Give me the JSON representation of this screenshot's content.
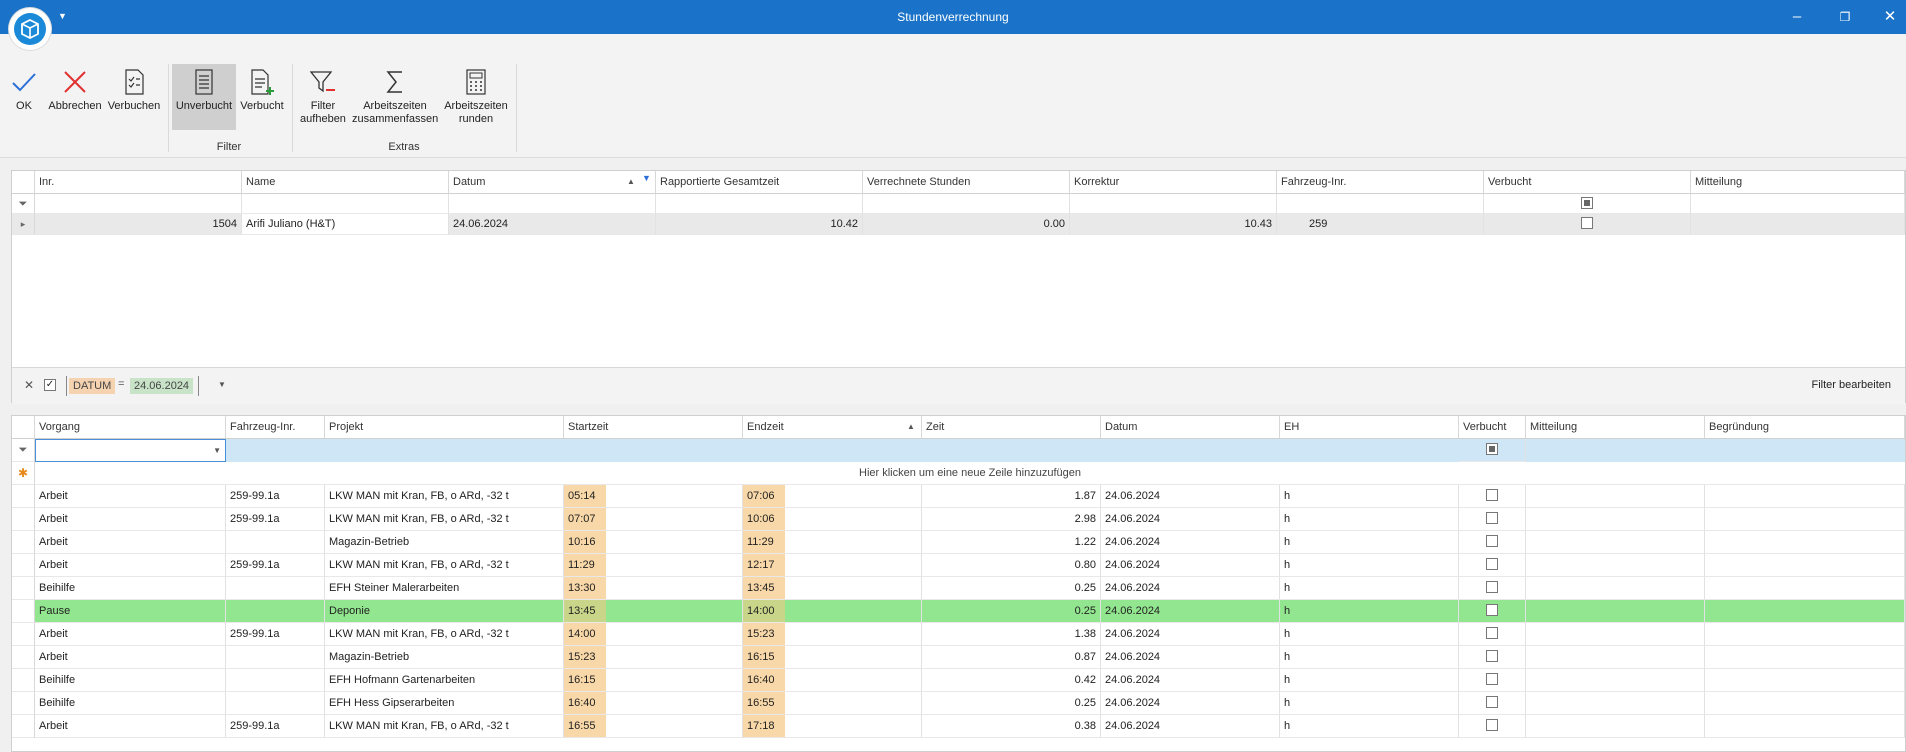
{
  "window": {
    "title": "Stundenverrechnung"
  },
  "ribbon": {
    "buttons": {
      "ok": "OK",
      "abbrechen": "Abbrechen",
      "verbuchen": "Verbuchen",
      "unverbucht": "Unverbucht",
      "verbucht": "Verbucht",
      "filter_aufheben_1": "Filter",
      "filter_aufheben_2": "aufheben",
      "zusammenfassen_1": "Arbeitszeiten",
      "zusammenfassen_2": "zusammenfassen",
      "runden_1": "Arbeitszeiten",
      "runden_2": "runden"
    },
    "groups": {
      "filter": "Filter",
      "extras": "Extras"
    }
  },
  "top_grid": {
    "columns": [
      "Inr.",
      "Name",
      "Datum",
      "Rapportierte Gesamtzeit",
      "Verrechnete Stunden",
      "Korrektur",
      "Fahrzeug-Inr.",
      "Verbucht",
      "Mitteilung"
    ],
    "row": {
      "inr": "1504",
      "name": "Arifi Juliano (H&T)",
      "datum": "24.06.2024",
      "gesamtzeit": "10.42",
      "verrechnet": "0.00",
      "korrektur": "10.43",
      "fahrzeug": "259"
    },
    "filter_panel": {
      "field": "DATUM",
      "op": "=",
      "value": "24.06.2024",
      "edit": "Filter bearbeiten"
    }
  },
  "bottom_grid": {
    "columns": [
      "Vorgang",
      "Fahrzeug-Inr.",
      "Projekt",
      "Startzeit",
      "Endzeit",
      "Zeit",
      "Datum",
      "EH",
      "Verbucht",
      "Mitteilung",
      "Begründung"
    ],
    "new_row_hint": "Hier klicken um eine neue Zeile hinzuzufügen",
    "rows": [
      {
        "vorgang": "Arbeit",
        "fahrzeug": "259-99.1a",
        "projekt": "LKW MAN mit Kran, FB, o ARd, -32 t",
        "start": "05:14",
        "end": "07:06",
        "zeit": "1.87",
        "datum": "24.06.2024",
        "eh": "h"
      },
      {
        "vorgang": "Arbeit",
        "fahrzeug": "259-99.1a",
        "projekt": "LKW MAN mit Kran, FB, o ARd, -32 t",
        "start": "07:07",
        "end": "10:06",
        "zeit": "2.98",
        "datum": "24.06.2024",
        "eh": "h"
      },
      {
        "vorgang": "Arbeit",
        "fahrzeug": "",
        "projekt": "Magazin-Betrieb",
        "start": "10:16",
        "end": "11:29",
        "zeit": "1.22",
        "datum": "24.06.2024",
        "eh": "h"
      },
      {
        "vorgang": "Arbeit",
        "fahrzeug": "259-99.1a",
        "projekt": "LKW MAN mit Kran, FB, o ARd, -32 t",
        "start": "11:29",
        "end": "12:17",
        "zeit": "0.80",
        "datum": "24.06.2024",
        "eh": "h"
      },
      {
        "vorgang": "Beihilfe",
        "fahrzeug": "",
        "projekt": "EFH Steiner Malerarbeiten",
        "start": "13:30",
        "end": "13:45",
        "zeit": "0.25",
        "datum": "24.06.2024",
        "eh": "h"
      },
      {
        "vorgang": "Pause",
        "fahrzeug": "",
        "projekt": "Deponie",
        "start": "13:45",
        "end": "14:00",
        "zeit": "0.25",
        "datum": "24.06.2024",
        "eh": "h",
        "highlight": true
      },
      {
        "vorgang": "Arbeit",
        "fahrzeug": "259-99.1a",
        "projekt": "LKW MAN mit Kran, FB, o ARd, -32 t",
        "start": "14:00",
        "end": "15:23",
        "zeit": "1.38",
        "datum": "24.06.2024",
        "eh": "h"
      },
      {
        "vorgang": "Arbeit",
        "fahrzeug": "",
        "projekt": "Magazin-Betrieb",
        "start": "15:23",
        "end": "16:15",
        "zeit": "0.87",
        "datum": "24.06.2024",
        "eh": "h"
      },
      {
        "vorgang": "Beihilfe",
        "fahrzeug": "",
        "projekt": "EFH Hofmann Gartenarbeiten",
        "start": "16:15",
        "end": "16:40",
        "zeit": "0.42",
        "datum": "24.06.2024",
        "eh": "h"
      },
      {
        "vorgang": "Beihilfe",
        "fahrzeug": "",
        "projekt": "EFH Hess Gipserarbeiten",
        "start": "16:40",
        "end": "16:55",
        "zeit": "0.25",
        "datum": "24.06.2024",
        "eh": "h"
      },
      {
        "vorgang": "Arbeit",
        "fahrzeug": "259-99.1a",
        "projekt": "LKW MAN mit Kran, FB, o ARd, -32 t",
        "start": "16:55",
        "end": "17:18",
        "zeit": "0.38",
        "datum": "24.06.2024",
        "eh": "h"
      }
    ]
  },
  "colors": {
    "titlebar": "#1a73c8",
    "time_highlight": "#f8d8a8",
    "pause_row": "#92e68f",
    "filter_row": "#cfe6f7"
  }
}
